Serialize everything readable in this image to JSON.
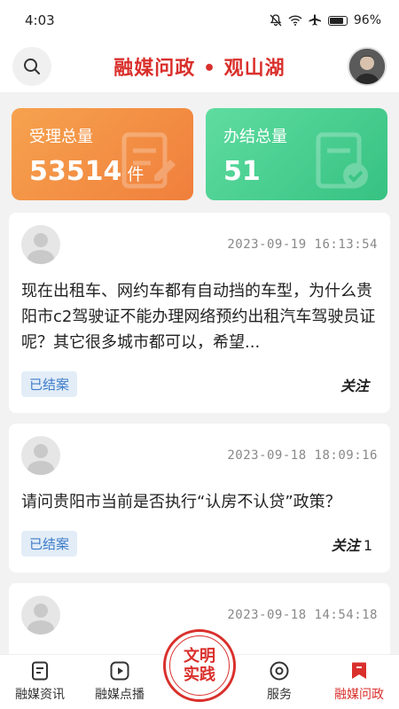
{
  "status": {
    "time": "4:03",
    "battery": "96%"
  },
  "header": {
    "title": "融媒问政 • 观山湖"
  },
  "stats": [
    {
      "label": "受理总量",
      "value": "53514",
      "unit": "件"
    },
    {
      "label": "办结总量",
      "value": "51"
    }
  ],
  "cards": [
    {
      "time": "2023-09-19 16:13:54",
      "text": "现在出租车、网约车都有自动挡的车型，为什么贵阳市c2驾驶证不能办理网络预约出租汽车驾驶员证呢？其它很多城市都可以，希望...",
      "status": "已结案",
      "follow": "关注",
      "follow_count": ""
    },
    {
      "time": "2023-09-18 18:09:16",
      "text": "请问贵阳市当前是否执行“认房不认贷”政策？",
      "status": "已结案",
      "follow": "关注",
      "follow_count": "1"
    },
    {
      "time": "2023-09-18 14:54:18",
      "text": "",
      "status": "",
      "follow": "",
      "follow_count": ""
    }
  ],
  "tabbar": {
    "items": [
      "融媒资讯",
      "融媒点播",
      "服务",
      "融媒问政"
    ],
    "center": [
      "文明",
      "实践"
    ]
  },
  "colors": {
    "accent": "#d9302c",
    "orange": "#f07f3c",
    "green": "#36c282",
    "badge_text": "#3d7cc9"
  }
}
